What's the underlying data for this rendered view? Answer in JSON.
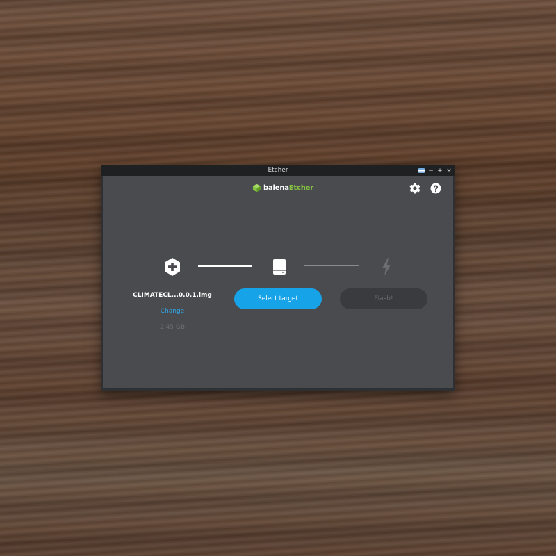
{
  "window": {
    "title": "Etcher",
    "controls": {
      "minimize": "−",
      "maximize": "+",
      "close": "×"
    }
  },
  "header": {
    "logo_prefix": "balena",
    "logo_suffix": "Etcher",
    "settings_icon": "gear-icon",
    "help_icon": "question-icon"
  },
  "steps": {
    "image": {
      "icon": "plus-hexagon-icon",
      "filename": "CLIMATECL...0.0.1.img",
      "change_label": "Change",
      "size": "2.45 GB"
    },
    "target": {
      "icon": "drive-icon",
      "button_label": "Select target"
    },
    "flash": {
      "icon": "lightning-icon",
      "button_label": "Flash!"
    }
  },
  "colors": {
    "accent": "#16a3e8",
    "logo_green": "#85c441",
    "background": "#4a4b4f",
    "link": "#2fa8ea"
  }
}
